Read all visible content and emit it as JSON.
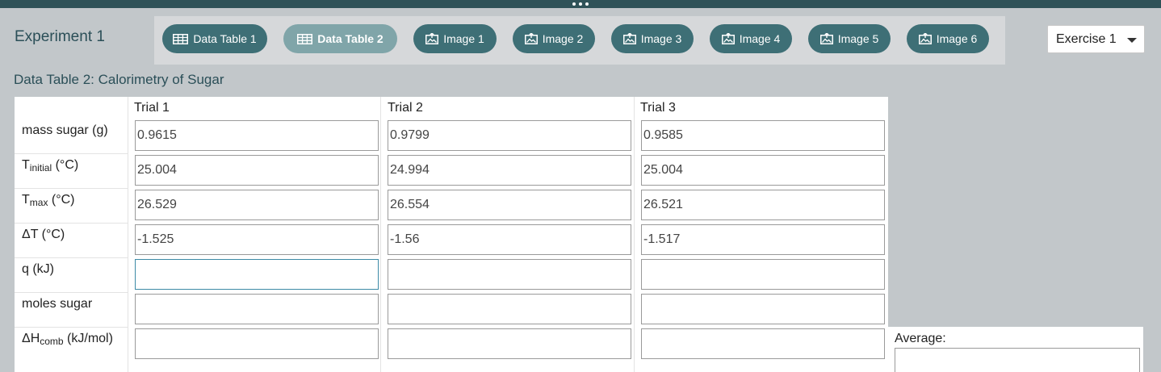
{
  "experiment": {
    "title": "Experiment 1"
  },
  "tabs": [
    {
      "label": "Data Table 1",
      "icon": "table-icon",
      "active": false
    },
    {
      "label": "Data Table 2",
      "icon": "table-icon",
      "active": true
    },
    {
      "label": "Image 1",
      "icon": "image-icon",
      "active": false
    },
    {
      "label": "Image 2",
      "icon": "image-icon",
      "active": false
    },
    {
      "label": "Image 3",
      "icon": "image-icon",
      "active": false
    },
    {
      "label": "Image 4",
      "icon": "image-icon",
      "active": false
    },
    {
      "label": "Image 5",
      "icon": "image-icon",
      "active": false
    },
    {
      "label": "Image 6",
      "icon": "image-icon",
      "active": false
    }
  ],
  "exercise_select": {
    "value": "Exercise 1"
  },
  "table": {
    "title": "Data Table 2: Calorimetry of Sugar",
    "columns": [
      "Trial 1",
      "Trial 2",
      "Trial 3"
    ],
    "rows": [
      {
        "label": "mass sugar (g)",
        "values": [
          "0.9615",
          "0.9799",
          "0.9585"
        ]
      },
      {
        "label_main": "T",
        "label_sub": "initial",
        "label_unit": " (°C)",
        "values": [
          "25.004",
          "24.994",
          "25.004"
        ]
      },
      {
        "label_main": "T",
        "label_sub": "max",
        "label_unit": " (°C)",
        "values": [
          "26.529",
          "26.554",
          "26.521"
        ]
      },
      {
        "label": "ΔT (°C)",
        "values": [
          "-1.525",
          "-1.56",
          "-1.517"
        ]
      },
      {
        "label": "q (kJ)",
        "values": [
          "",
          "",
          ""
        ]
      },
      {
        "label": "moles sugar",
        "values": [
          "",
          "",
          ""
        ]
      },
      {
        "label_main": "ΔH",
        "label_sub": "comb",
        "label_unit": " (kJ/mol)",
        "values": [
          "",
          "",
          ""
        ]
      }
    ],
    "average_label": "Average:",
    "average_value": ""
  },
  "colors": {
    "topbar": "#2f5258",
    "tab": "#3e6f76",
    "tab_active": "#80a5a9",
    "background": "#c2c7ca",
    "focus_border": "#3d8aa6"
  }
}
